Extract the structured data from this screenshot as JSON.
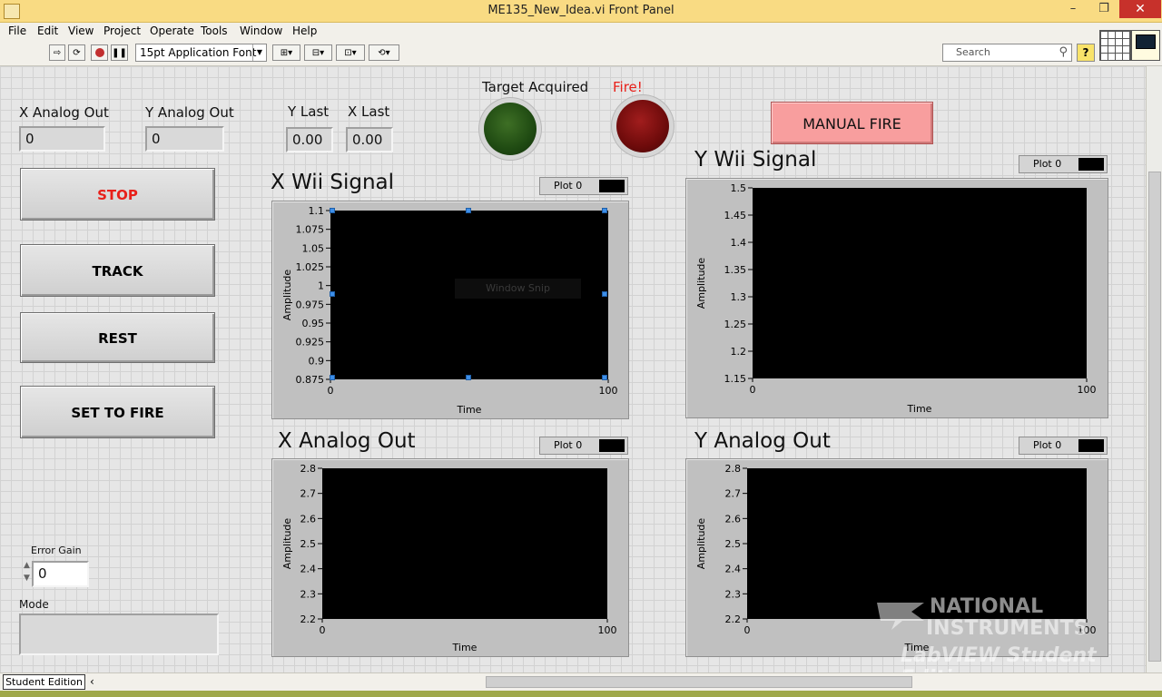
{
  "window": {
    "title": "ME135_New_Idea.vi Front Panel",
    "close_glyph": "✕",
    "min_glyph": "–",
    "max_glyph": "❐"
  },
  "menu": [
    "File",
    "Edit",
    "View",
    "Project",
    "Operate",
    "Tools",
    "Window",
    "Help"
  ],
  "toolbar": {
    "font": "15pt Application Font",
    "search_placeholder": "Search",
    "help": "?"
  },
  "indicators": {
    "x_analog_out": {
      "label": "X Analog Out",
      "value": "0"
    },
    "y_analog_out": {
      "label": "Y Analog Out",
      "value": "0"
    },
    "y_last": {
      "label": "Y Last",
      "value": "0.00"
    },
    "x_last": {
      "label": "X Last",
      "value": "0.00"
    }
  },
  "buttons": {
    "stop": "STOP",
    "track": "TRACK",
    "rest": "REST",
    "set_to_fire": "SET TO FIRE",
    "manual_fire": "MANUAL FIRE"
  },
  "leds": {
    "target_acquired": "Target Acquired",
    "fire": "Fire!"
  },
  "error_gain": {
    "label": "Error Gain",
    "value": "0"
  },
  "mode": {
    "label": "Mode",
    "value": ""
  },
  "snip_label": "Window Snip",
  "status": {
    "tab": "Student Edition"
  },
  "watermark": {
    "line1": "NATIONAL",
    "line2": "INSTRUMENTS",
    "line3": "LabVIEW Student Edition"
  },
  "colors": {
    "accent_stop": "#e8201a",
    "fire_label": "#e8201a",
    "led_green": "#1f4a12",
    "led_red": "#6e0b0b",
    "manual_fire_bg": "#f89e9e"
  },
  "chart_data": [
    {
      "type": "line",
      "title": "X Wii Signal",
      "legend": "Plot 0",
      "xlabel": "Time",
      "ylabel": "Amplitude",
      "xlim": [
        0,
        100
      ],
      "ylim": [
        0.875,
        1.1
      ],
      "x_ticks": [
        "0",
        "100"
      ],
      "y_ticks": [
        "1.1",
        "1.075",
        "1.05",
        "1.025",
        "1",
        "0.975",
        "0.95",
        "0.925",
        "0.9",
        "0.875"
      ],
      "series": []
    },
    {
      "type": "line",
      "title": "Y Wii Signal",
      "legend": "Plot 0",
      "xlabel": "Time",
      "ylabel": "Amplitude",
      "xlim": [
        0,
        100
      ],
      "ylim": [
        1.15,
        1.5
      ],
      "x_ticks": [
        "0",
        "100"
      ],
      "y_ticks": [
        "1.5",
        "1.45",
        "1.4",
        "1.35",
        "1.3",
        "1.25",
        "1.2",
        "1.15"
      ],
      "series": []
    },
    {
      "type": "line",
      "title": "X Analog Out",
      "legend": "Plot 0",
      "xlabel": "Time",
      "ylabel": "Amplitude",
      "xlim": [
        0,
        100
      ],
      "ylim": [
        2.2,
        2.8
      ],
      "x_ticks": [
        "0",
        "100"
      ],
      "y_ticks": [
        "2.8",
        "2.7",
        "2.6",
        "2.5",
        "2.4",
        "2.3",
        "2.2"
      ],
      "series": []
    },
    {
      "type": "line",
      "title": "Y Analog Out",
      "legend": "Plot 0",
      "xlabel": "Time",
      "ylabel": "Amplitude",
      "xlim": [
        0,
        100
      ],
      "ylim": [
        2.2,
        2.8
      ],
      "x_ticks": [
        "0",
        "100"
      ],
      "y_ticks": [
        "2.8",
        "2.7",
        "2.6",
        "2.5",
        "2.4",
        "2.3",
        "2.2"
      ],
      "series": []
    }
  ]
}
